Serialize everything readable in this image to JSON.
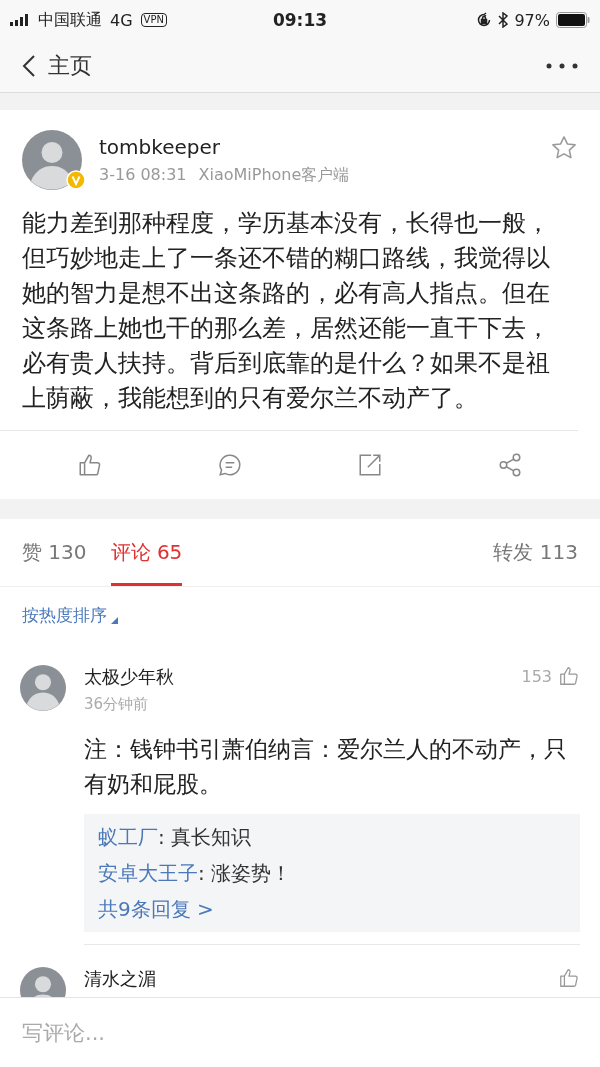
{
  "status_bar": {
    "carrier": "中国联通",
    "network": "4G",
    "vpn": "VPN",
    "time": "09:13",
    "battery": "97%"
  },
  "nav": {
    "back_label": "主页"
  },
  "post": {
    "author": "tombkeeper",
    "verified": true,
    "time": "3-16 08:31",
    "source": "XiaoMiPhone客户端",
    "text": "能力差到那种程度，学历基本没有，长得也一般，但巧妙地走上了一条还不错的糊口路线，我觉得以她的智力是想不出这条路的，必有高人指点。但在这条路上她也干的那么差，居然还能一直干下去，必有贵人扶持。背后到底靠的是什么？如果不是祖上荫蔽，我能想到的只有爱尔兰不动产了。"
  },
  "tabs": [
    {
      "label": "赞 130",
      "selected": false
    },
    {
      "label": "评论 65",
      "selected": true
    },
    {
      "label": "转发 113",
      "selected": false
    }
  ],
  "sort": {
    "label": "按热度排序"
  },
  "comments": [
    {
      "author": "太极少年秋",
      "likes": "153",
      "time": "36分钟前",
      "text": "注：钱钟书引萧伯纳言：爱尔兰人的不动产，只有奶和屁股。",
      "replies": [
        {
          "author": "蚁工厂",
          "text": ": 真长知识"
        },
        {
          "author": "安卓大王子",
          "text": ": 涨姿势！"
        }
      ],
      "more_replies": "共9条回复 >"
    },
    {
      "author": "清水之湄"
    }
  ],
  "composer": {
    "placeholder": "写评论..."
  }
}
